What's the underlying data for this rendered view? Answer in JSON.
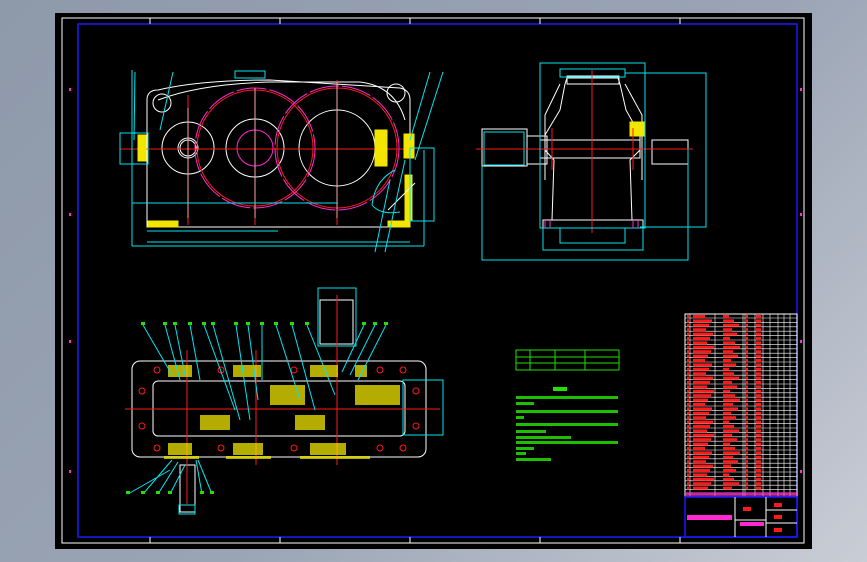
{
  "viewer": {
    "background_color": "#000000",
    "frame_color": "#ffffff",
    "border_color": "#1a1aff"
  },
  "drawing": {
    "views": [
      "front-view",
      "side-view",
      "plan-view"
    ],
    "colors": {
      "outline": "#ffffff",
      "dimension": "#00e5f0",
      "centerline": "#ff1a1a",
      "pitch_circle": "#ff2bd0",
      "hatch": "#f2e600",
      "annotation": "#22e000",
      "parts_list_text": "#ff1a1a"
    }
  }
}
